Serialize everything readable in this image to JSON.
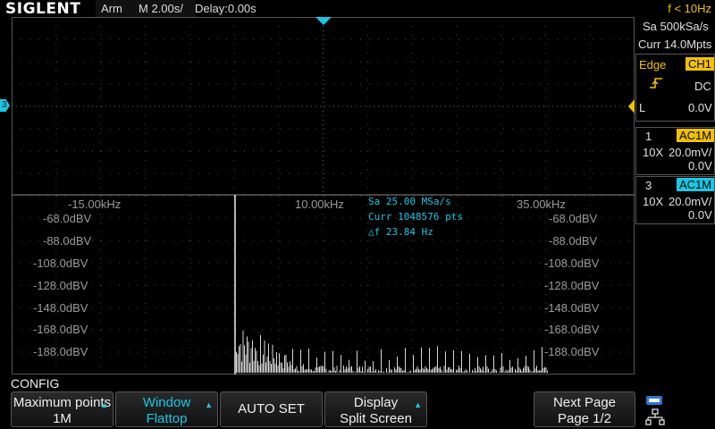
{
  "topbar": {
    "brand": "SIGLENT",
    "status": "Arm",
    "timebase": "M 2.00s/",
    "delay": "Delay:0.00s",
    "freq": "f < 10Hz"
  },
  "acq": {
    "sample_rate": "Sa 500kSa/s",
    "memory": "Curr 14.0Mpts"
  },
  "trigger": {
    "type": "Edge",
    "source": "CH1",
    "coupling": "DC",
    "level_label": "L",
    "level": "0.0V"
  },
  "channels": [
    {
      "num": "1",
      "coupling": "AC1M",
      "probe": "10X",
      "scale": "20.0mV/",
      "offset": "0.0V"
    },
    {
      "num": "3",
      "coupling": "AC1M",
      "probe": "10X",
      "scale": "20.0mV/",
      "offset": "0.0V"
    }
  ],
  "fft": {
    "x_ticks": [
      "-15.00kHz",
      "10.00kHz",
      "35.00kHz"
    ],
    "y_ticks": [
      "-68.0dBV",
      "-88.0dBV",
      "-108.0dBV",
      "-128.0dBV",
      "-148.0dBV",
      "-168.0dBV",
      "-188.0dBV"
    ],
    "info_sa": "Sa 25.00 MSa/s",
    "info_curr": "Curr 1048576 pts",
    "info_df": "△f 23.84 Hz"
  },
  "channel_marker": "3",
  "menu": {
    "title": "CONFIG",
    "softkeys": [
      {
        "l1": "Maximum points",
        "l2": "1M"
      },
      {
        "l1": "Window",
        "l2": "Flattop"
      },
      {
        "l1": "AUTO SET",
        "l2": ""
      },
      {
        "l1": "Display",
        "l2": "Split Screen"
      },
      {
        "l1": "Next Page",
        "l2": "Page 1/2"
      }
    ]
  },
  "colors": {
    "accent": "#19c8e6",
    "trigger": "#f2c200",
    "trace": "#e0e0e0"
  },
  "icons": [
    "usb-icon",
    "network-icon",
    "trigger-edge-icon",
    "menu-arrow-icon"
  ]
}
